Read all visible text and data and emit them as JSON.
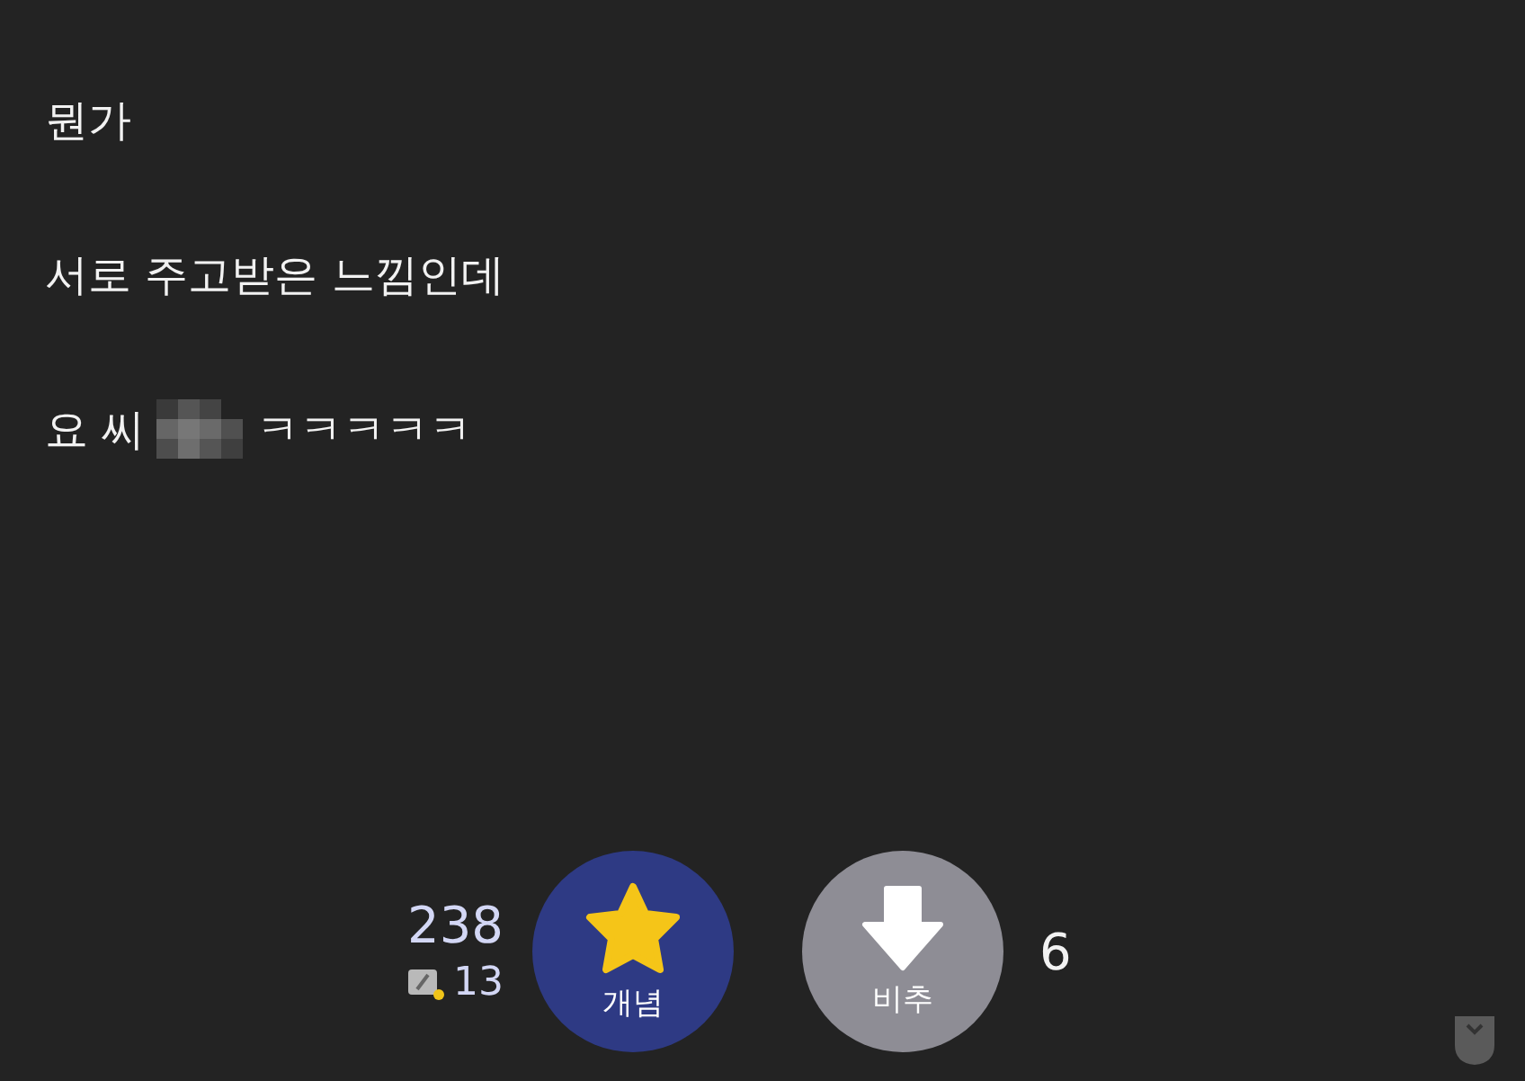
{
  "post": {
    "paragraphs": [
      {
        "segments": [
          {
            "kind": "text",
            "text": "뭔가"
          }
        ]
      },
      {
        "segments": [
          {
            "kind": "text",
            "text": "서로 주고받은 느낌인데"
          }
        ]
      },
      {
        "segments": [
          {
            "kind": "text",
            "text": "요 씨"
          },
          {
            "kind": "censored"
          },
          {
            "kind": "text",
            "text": "ㅋㅋㅋㅋㅋ"
          }
        ]
      }
    ]
  },
  "votes": {
    "upvote": {
      "count": "238",
      "fixed_count": "13",
      "label": "개념"
    },
    "downvote": {
      "label": "비추",
      "count": "6"
    }
  }
}
